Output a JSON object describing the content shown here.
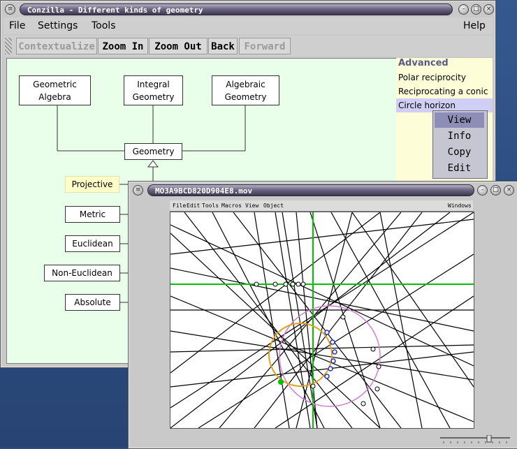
{
  "main_window": {
    "title": "Conzilla - Different kinds of geometry",
    "menu": [
      "File",
      "Settings",
      "Tools"
    ],
    "help": "Help",
    "toolbar": {
      "contextualize": "Contextualize",
      "zoom_in": "Zoom In",
      "zoom_out": "Zoom Out",
      "back": "Back",
      "forward": "Forward"
    },
    "nodes": {
      "geometric_algebra": "Geometric Algebra",
      "integral_geometry": "Integral Geometry",
      "algebraic_geometry": "Algebraic Geometry",
      "geometry": "Geometry",
      "projective": "Projective",
      "metric": "Metric",
      "euclidean": "Euclidean",
      "non_euclidean": "Non-Euclidean",
      "absolute": "Absolute"
    },
    "side_panel": {
      "title": "Advanced",
      "items": [
        "Polar reciprocity",
        "Reciprocating a conic",
        "Circle horizon"
      ]
    },
    "context_menu": [
      "View",
      "Info",
      "Copy",
      "Edit"
    ]
  },
  "movie_window": {
    "title": "MO3A9BCD820D904E8.mov",
    "menu": [
      "File",
      "Edit",
      "Tools",
      "Macros",
      "View",
      "Object"
    ],
    "menu_right": "Windows"
  },
  "colors": {
    "accent_green": "#00c000",
    "circle_orange": "#e0a020",
    "circle_pink": "#d080d0",
    "point_blue": "#2030c0"
  }
}
